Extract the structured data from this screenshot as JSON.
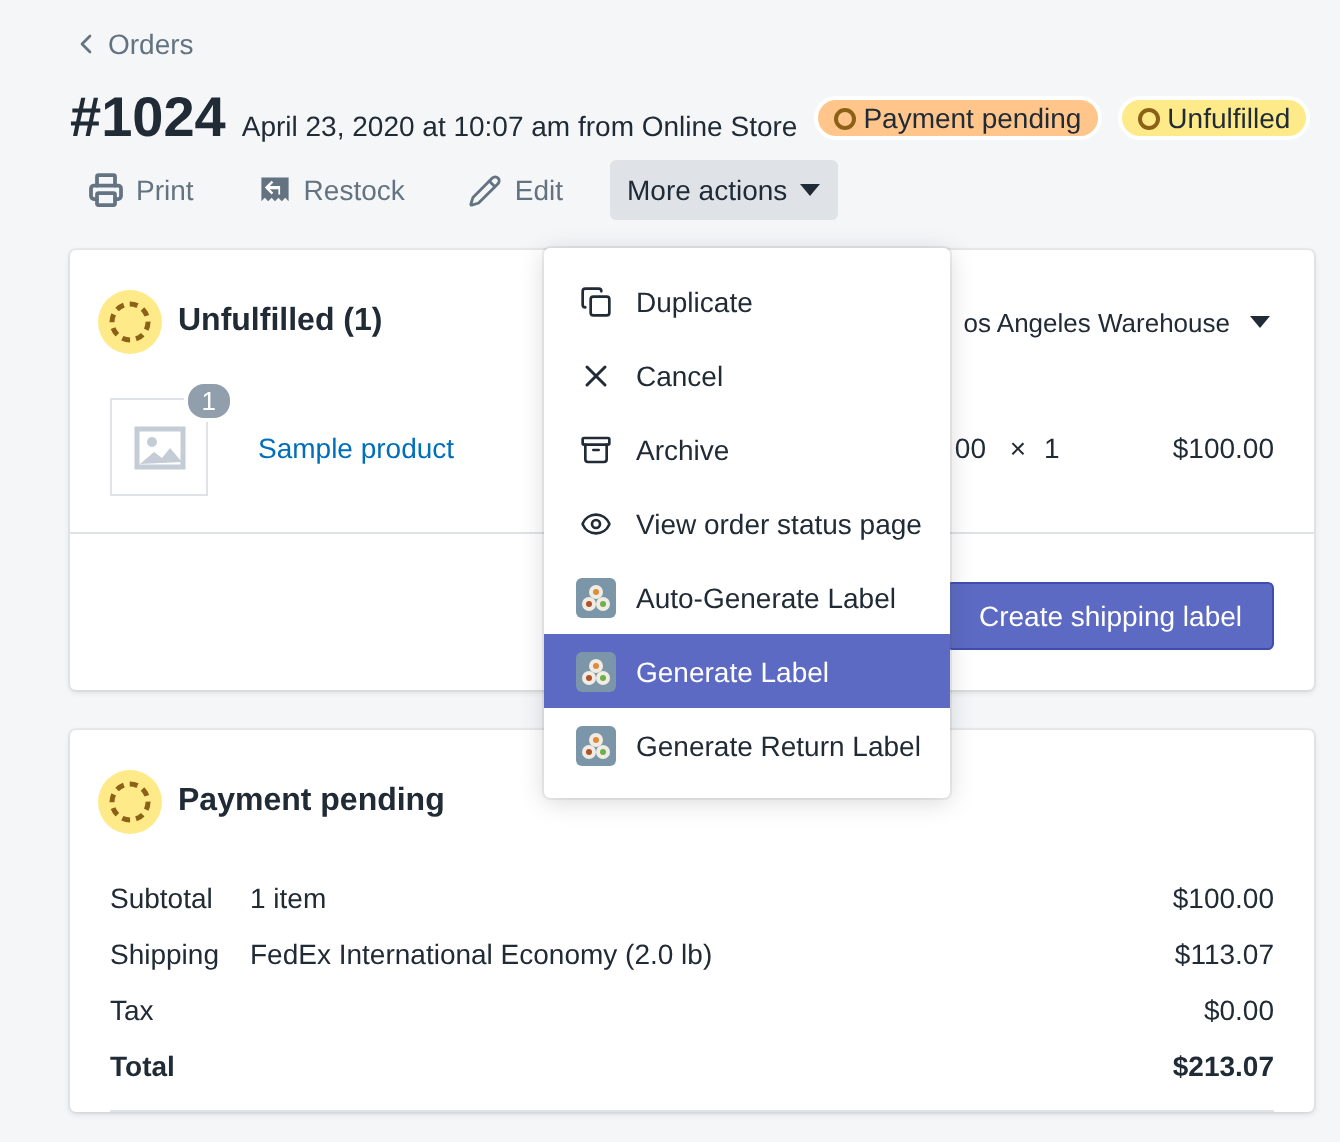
{
  "back_link": {
    "label": "Orders"
  },
  "order": {
    "number": "#1024",
    "meta": "April 23, 2020 at 10:07 am from Online Store",
    "badges": [
      {
        "label": "Payment pending",
        "color": "#ffc58b"
      },
      {
        "label": "Unfulfilled",
        "color": "#ffea8a"
      }
    ]
  },
  "actions": [
    {
      "label": "Print",
      "kind": "plain"
    },
    {
      "label": "Restock",
      "kind": "plain"
    },
    {
      "label": "Edit",
      "kind": "plain"
    },
    {
      "label": "More actions",
      "kind": "menu",
      "expanded": true
    }
  ],
  "menu": [
    {
      "label": "Duplicate",
      "kind": "action",
      "selected": false
    },
    {
      "label": "Cancel",
      "kind": "action",
      "selected": false
    },
    {
      "label": "Archive",
      "kind": "action",
      "selected": false
    },
    {
      "label": "View order status page",
      "kind": "action",
      "selected": false
    },
    {
      "label": "Auto-Generate Label",
      "kind": "app",
      "selected": false
    },
    {
      "label": "Generate Label",
      "kind": "app",
      "selected": true
    },
    {
      "label": "Generate Return Label",
      "kind": "app",
      "selected": false
    }
  ],
  "fulfillment": {
    "title": "Unfulfilled (1)",
    "location": "os Angeles Warehouse",
    "items": [
      {
        "quantity_badge": "1",
        "name": "Sample product",
        "price": "00",
        "times": "×",
        "quantity": "1",
        "total": "$100.00"
      }
    ],
    "button": "Create shipping label"
  },
  "payment": {
    "title": "Payment pending",
    "rows": [
      {
        "label": "Subtotal",
        "detail": "1 item",
        "amount": "$100.00",
        "kind": "normal"
      },
      {
        "label": "Shipping",
        "detail": "FedEx International Economy (2.0 lb)",
        "amount": "$113.07",
        "kind": "normal"
      },
      {
        "label": "Tax",
        "amount": "$0.00",
        "kind": "normal"
      },
      {
        "label": "Total",
        "amount": "$213.07",
        "kind": "total"
      }
    ]
  }
}
